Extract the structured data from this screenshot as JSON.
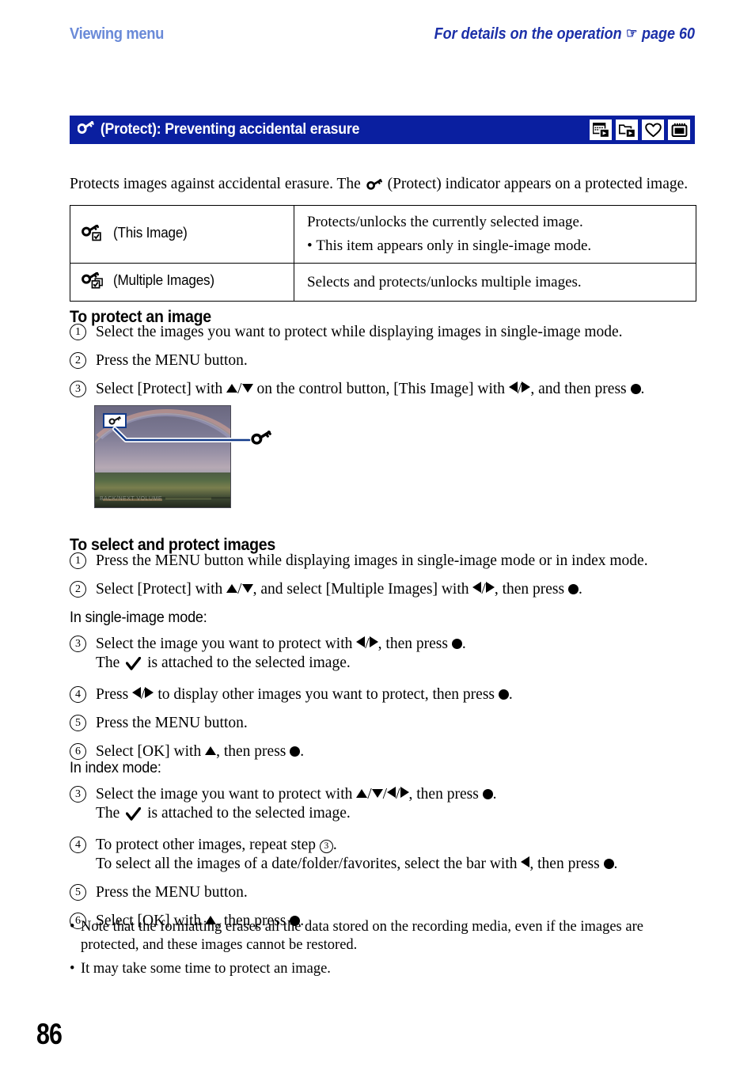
{
  "running_head": {
    "left": "Viewing menu",
    "right_text": "For details on the operation",
    "hand_icon": "pointing-hand-icon",
    "page_ref": "page 60"
  },
  "section": {
    "icon": "key-icon",
    "title": "(Protect): Preventing accidental erasure",
    "mode_icons": [
      {
        "name": "date-view-icon",
        "label": "Date View"
      },
      {
        "name": "folder-view-icon",
        "label": "Folder View"
      },
      {
        "name": "favorites-heart-icon",
        "label": "Favorites"
      },
      {
        "name": "memory-card-icon",
        "label": "Memory Card"
      }
    ]
  },
  "intro": {
    "before": "Protects images against accidental erasure. The",
    "icon": "key-icon",
    "after": "(Protect) indicator appears on a protected image."
  },
  "table": {
    "rows": [
      {
        "icon": "key-single-check-icon",
        "label": "(This Image)",
        "desc": "Protects/unlocks the currently selected image.",
        "bullet": "This item appears only in single-image mode."
      },
      {
        "icon": "key-multiple-check-icon",
        "label": "(Multiple Images)",
        "desc": "Selects and protects/unlocks multiple images.",
        "bullet": ""
      }
    ]
  },
  "protect_section": {
    "heading": "To protect an image",
    "steps": [
      {
        "num": "1",
        "parts": [
          "Select the images you want to protect while displaying images in single-image mode."
        ]
      },
      {
        "num": "2",
        "parts": [
          "Press the MENU button."
        ]
      },
      {
        "num": "3",
        "parts": [
          "Select [Protect] with ",
          " on the control button, [This Image] with ",
          ", and then press ",
          "."
        ]
      }
    ],
    "step3": {
      "a": "Select [Protect] with",
      "b": "on the control button, [This Image] with",
      "c": ", and then press",
      "d": "."
    }
  },
  "illustration": {
    "photo_badge_icon": "protect-key-indicator",
    "callout_icon": "key-icon",
    "osd_text": "BACK/NEXT    VOLUME"
  },
  "select_section": {
    "heading": "To select and protect images",
    "step1": "Press the MENU button while displaying images in single-image mode or in index mode.",
    "step2": {
      "a": "Select [Protect] with",
      "b": ", and select [Multiple Images] with",
      "c": ", then press",
      "d": "."
    },
    "single_label": "In single-image mode:",
    "single_steps": {
      "s3a": "Select the image you want to protect with",
      "s3b": ", then press",
      "s3c": ".",
      "s3_sub_a": "The",
      "s3_sub_b": "is attached to the selected image.",
      "s4a": "Press",
      "s4b": "to display other images you want to protect, then press",
      "s4c": ".",
      "s5": "Press the MENU button.",
      "s6a": "Select [OK] with",
      "s6b": ", then press",
      "s6c": "."
    },
    "index_label": "In index mode:",
    "index_steps": {
      "s3a": "Select the image you want to protect with",
      "s3b": ", then press",
      "s3c": ".",
      "s3_sub_a": "The",
      "s3_sub_b": "is attached to the selected image.",
      "s4a": "To protect other images, repeat step",
      "s4b": ".",
      "s4_sub_a": "To select all the images of a date/folder/favorites, select the bar with",
      "s4_sub_b": ", then press",
      "s4_sub_c": ".",
      "s5": "Press the MENU button.",
      "s6a": "Select [OK] with",
      "s6b": ", then press",
      "s6c": "."
    }
  },
  "notes": [
    "Note that the formatting erases all the data stored on the recording media, even if the images are protected, and these images cannot be restored.",
    "It may take some time to protect an image."
  ],
  "folio": "86",
  "colors": {
    "section_bar_blue": "#0A1FA0",
    "head_left_blue": "#6A8AD8",
    "head_right_blue": "#1B2FA8",
    "callout_blue": "#123A8A"
  }
}
